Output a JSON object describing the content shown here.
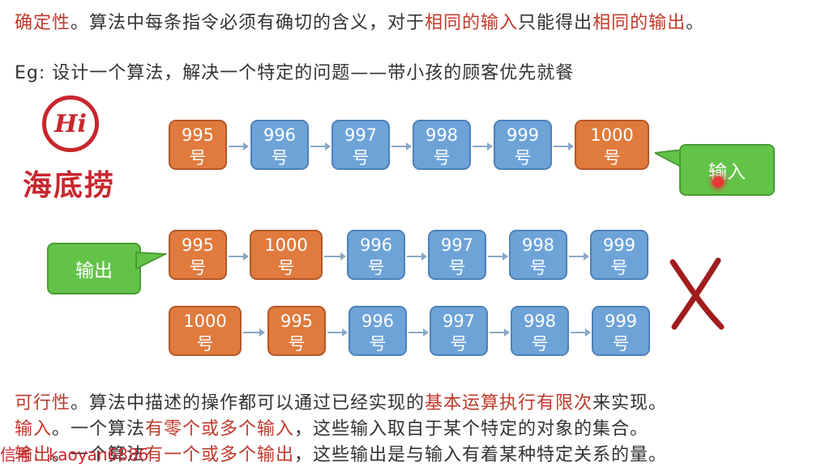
{
  "line1": {
    "p1": "确定性",
    "p2": "。算法中每条指令必须有确切的含义，对于",
    "p3": "相同的输入",
    "p4": "只能得出",
    "p5": "相同的输出",
    "p6": "。"
  },
  "eg_line": "Eg: 设计一个算法，解决一个特定的问题——带小孩的顾客优先就餐",
  "logo": {
    "mark": "Hi",
    "name": "海底捞"
  },
  "row1": [
    {
      "num": "995",
      "unit": "号",
      "color": "orange"
    },
    {
      "num": "996",
      "unit": "号",
      "color": "blue"
    },
    {
      "num": "997",
      "unit": "号",
      "color": "blue"
    },
    {
      "num": "998",
      "unit": "号",
      "color": "blue"
    },
    {
      "num": "999",
      "unit": "号",
      "color": "blue"
    },
    {
      "num": "1000",
      "unit": "号",
      "color": "orange"
    }
  ],
  "row2": [
    {
      "num": "995",
      "unit": "号",
      "color": "orange"
    },
    {
      "num": "1000",
      "unit": "号",
      "color": "orange"
    },
    {
      "num": "996",
      "unit": "号",
      "color": "blue"
    },
    {
      "num": "997",
      "unit": "号",
      "color": "blue"
    },
    {
      "num": "998",
      "unit": "号",
      "color": "blue"
    },
    {
      "num": "999",
      "unit": "号",
      "color": "blue"
    }
  ],
  "row3": [
    {
      "num": "1000",
      "unit": "号",
      "color": "orange"
    },
    {
      "num": "995",
      "unit": "号",
      "color": "orange"
    },
    {
      "num": "996",
      "unit": "号",
      "color": "blue"
    },
    {
      "num": "997",
      "unit": "号",
      "color": "blue"
    },
    {
      "num": "998",
      "unit": "号",
      "color": "blue"
    },
    {
      "num": "999",
      "unit": "号",
      "color": "blue"
    }
  ],
  "callouts": {
    "input": "输入",
    "output": "输出"
  },
  "line_feasible": {
    "p1": "可行性",
    "p2": "。算法中描述的操作都可以通过已经实现的",
    "p3": "基本运算执行有限次",
    "p4": "来实现。"
  },
  "line_input": {
    "p1": "输入",
    "p2": "。一个算法",
    "p3": "有零个或多个输入",
    "p4": "，这些输入取自于某个特定的对象的集合。"
  },
  "line_output": {
    "p1": "输出",
    "p2": "。一个算法",
    "p3": "有一个或多个输出",
    "p4": "，这些输出是与输入有着某种特定关系的量。"
  },
  "watermark": "信号：kaoyan6886",
  "colors": {
    "orange": "#e07a3d",
    "blue": "#6ea3d8",
    "red": "#c0392b",
    "green": "#63c349"
  }
}
